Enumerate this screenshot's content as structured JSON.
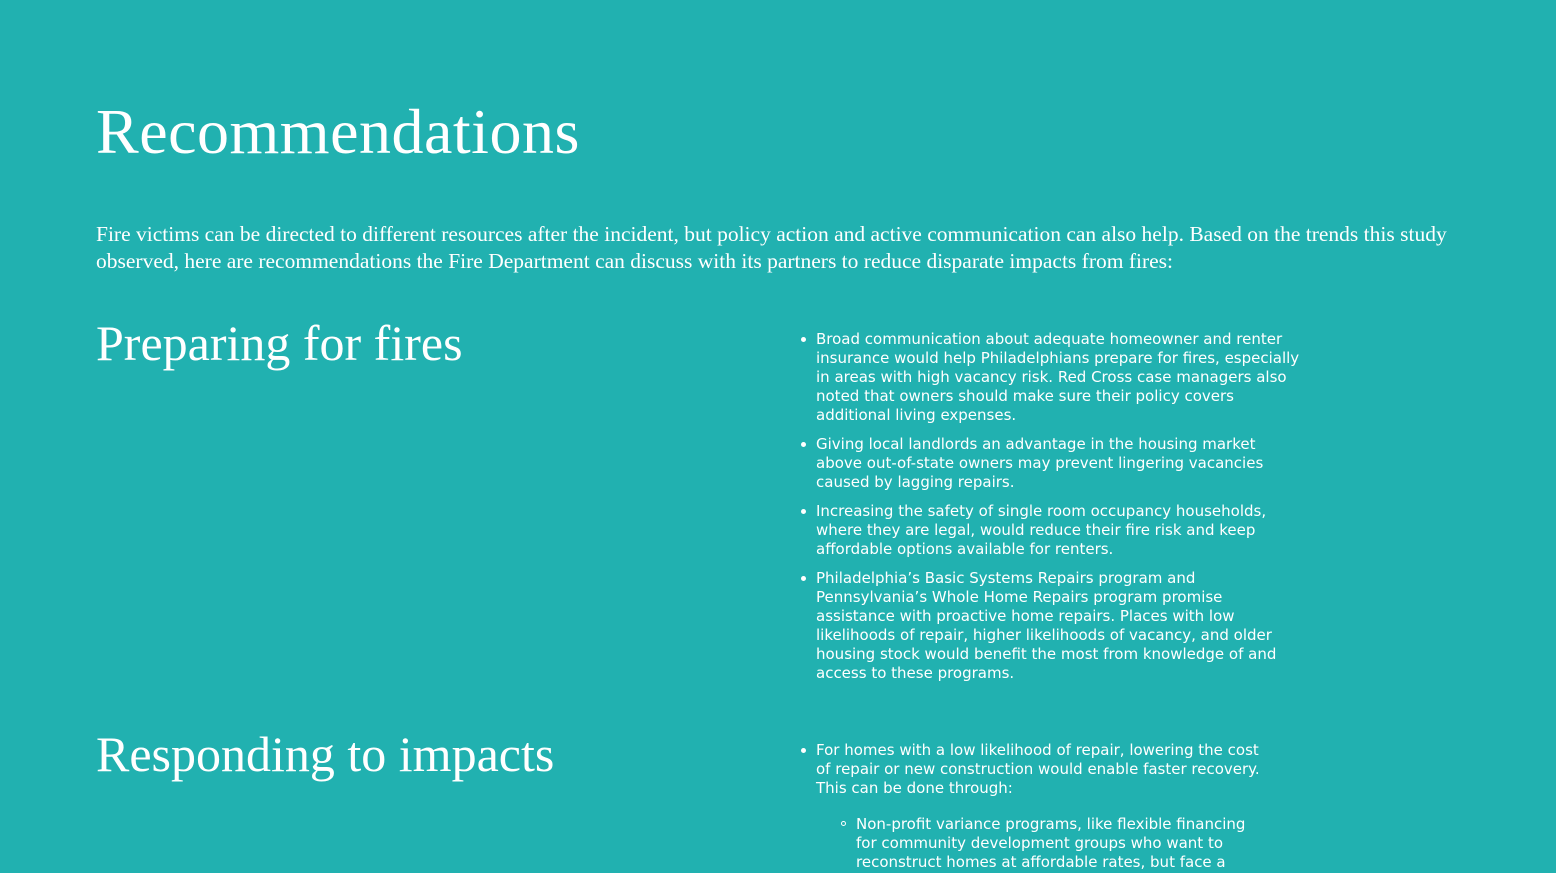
{
  "title": "Recommendations",
  "intro": "Fire victims can be directed to different resources after the incident, but policy action and active communication can also help. Based on the trends this study observed, here are recommendations the Fire Department can discuss with its partners to reduce disparate impacts from fires:",
  "sections": [
    {
      "heading": "Preparing for fires",
      "bullets": [
        "Broad communication about adequate homeowner and renter insurance would help Philadelphians prepare for fires, especially in areas with high vacancy risk. Red Cross case managers also noted that owners should make sure their policy covers additional living expenses.",
        "Giving local landlords an advantage in the housing market above out-of-state owners may prevent lingering vacancies caused by lagging repairs.",
        "Increasing the safety of single room occupancy households, where they are legal, would reduce their fire risk and keep affordable options available for renters.",
        "Philadelphia’s Basic Systems Repairs program and Pennsylvania’s Whole Home Repairs program promise assistance with proactive home repairs. Places with low likelihoods of repair, higher likelihoods of vacancy, and older housing stock would benefit the most from knowledge of and access to these programs."
      ]
    },
    {
      "heading": "Responding to impacts",
      "bullets": [
        "For homes with a low likelihood of repair, lowering the cost of repair or new construction would enable faster recovery. This can be done through:"
      ],
      "sub_bullets": [
        "Non-profit variance programs, like flexible financing for community development groups who want to reconstruct homes at affordable rates, but face a"
      ]
    }
  ]
}
